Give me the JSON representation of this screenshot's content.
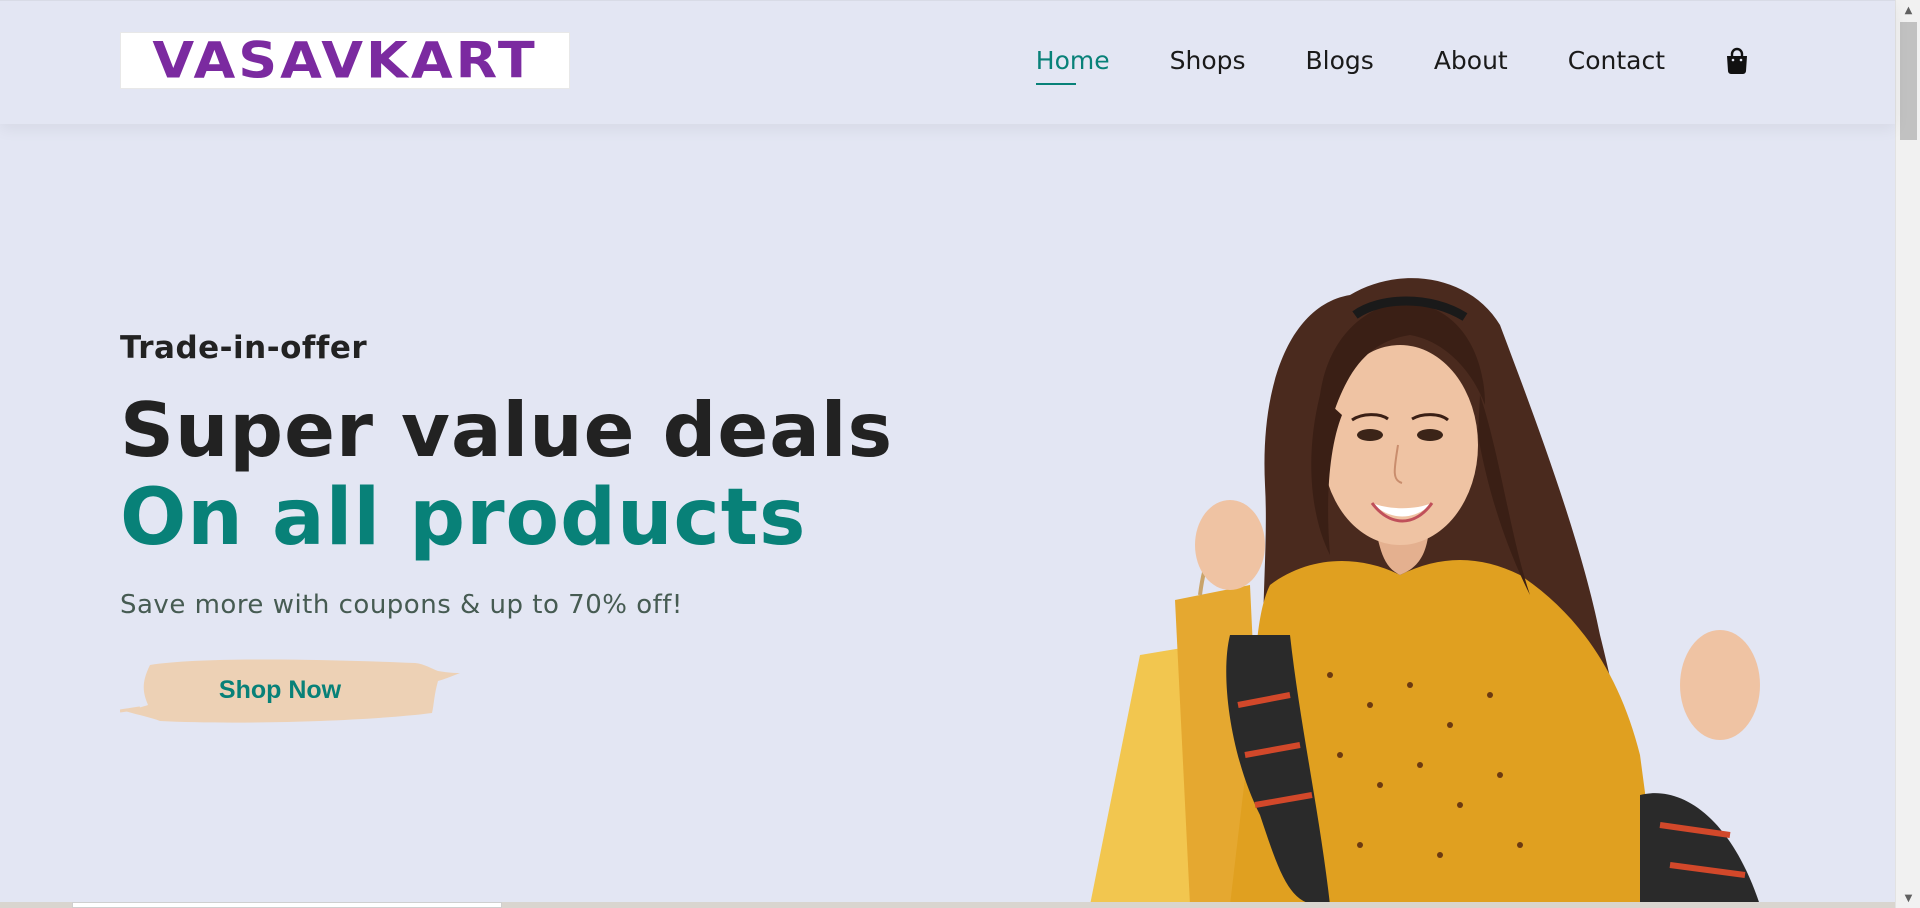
{
  "header": {
    "logo_text": "VASAVKART",
    "nav": [
      {
        "label": "Home",
        "active": true
      },
      {
        "label": "Shops",
        "active": false
      },
      {
        "label": "Blogs",
        "active": false
      },
      {
        "label": "About",
        "active": false
      },
      {
        "label": "Contact",
        "active": false
      }
    ],
    "cart_icon": "shopping-bag-icon"
  },
  "hero": {
    "tagline": "Trade-in-offer",
    "headline_line1": "Super value deals",
    "headline_line2": "On all products",
    "subtext": "Save more with coupons & up to 70% off!",
    "button_label": "Shop Now"
  },
  "colors": {
    "background": "#e3e6f3",
    "accent": "#088178",
    "logo": "#7b2aa0",
    "button_brush": "#edd1b5",
    "dress": "#e0a020"
  }
}
